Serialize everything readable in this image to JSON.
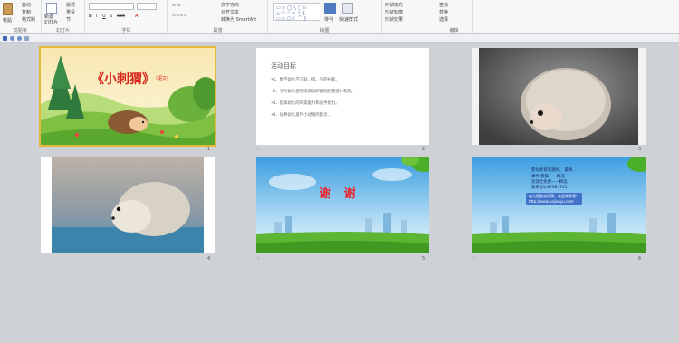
{
  "ribbon": {
    "clipboard": {
      "paste": "粘贴",
      "cut": "剪切",
      "copy": "复制",
      "format_painter": "格式刷",
      "group": "剪贴板"
    },
    "slides": {
      "new_slide": "新建\n幻灯片",
      "layout": "版式",
      "reset": "重设",
      "section": "节",
      "group": "幻灯片"
    },
    "font": {
      "group": "字体"
    },
    "paragraph": {
      "text_direction": "文字方向",
      "align_text": "对齐文本",
      "smartart": "转换为 SmartArt",
      "group": "段落"
    },
    "drawing": {
      "arrange": "排列",
      "quick_styles": "快速样式",
      "shape_fill": "形状填充",
      "shape_outline": "形状轮廓",
      "shape_effects": "形状效果",
      "group": "绘图"
    },
    "editing": {
      "find": "查找",
      "replace": "替换",
      "select": "选择",
      "group": "编辑"
    }
  },
  "slides": [
    {
      "number": "1",
      "title": "《小刺猬》",
      "tag": "（语文）"
    },
    {
      "number": "2",
      "heading": "活动目标",
      "items": [
        "•1、数学幼儿学习双、摆、钓的技能。",
        "•2、引导幼儿使用滚滚玩印碾刮胶塑造小刺猬。",
        "•3、提高幼儿的审美能力和动手能力。",
        "•4、培养幼儿爱护小动物的意识 。"
      ]
    },
    {
      "number": "3"
    },
    {
      "number": "4"
    },
    {
      "number": "5",
      "title": "谢   谢"
    },
    {
      "number": "6",
      "lines": [
        "婴幼教育资源网，  最精...",
        "课件/教案——精选",
        "资源全免费——精选",
        "联系QQ:87984701"
      ],
      "box": [
        "幼儿园教育资源，欢迎来参观！",
        "http://www.yejiaoyu.com"
      ]
    }
  ],
  "colors": {
    "selection": "#e2b93b",
    "thanks_red": "#e8262e",
    "title_red": "#d8271c"
  }
}
